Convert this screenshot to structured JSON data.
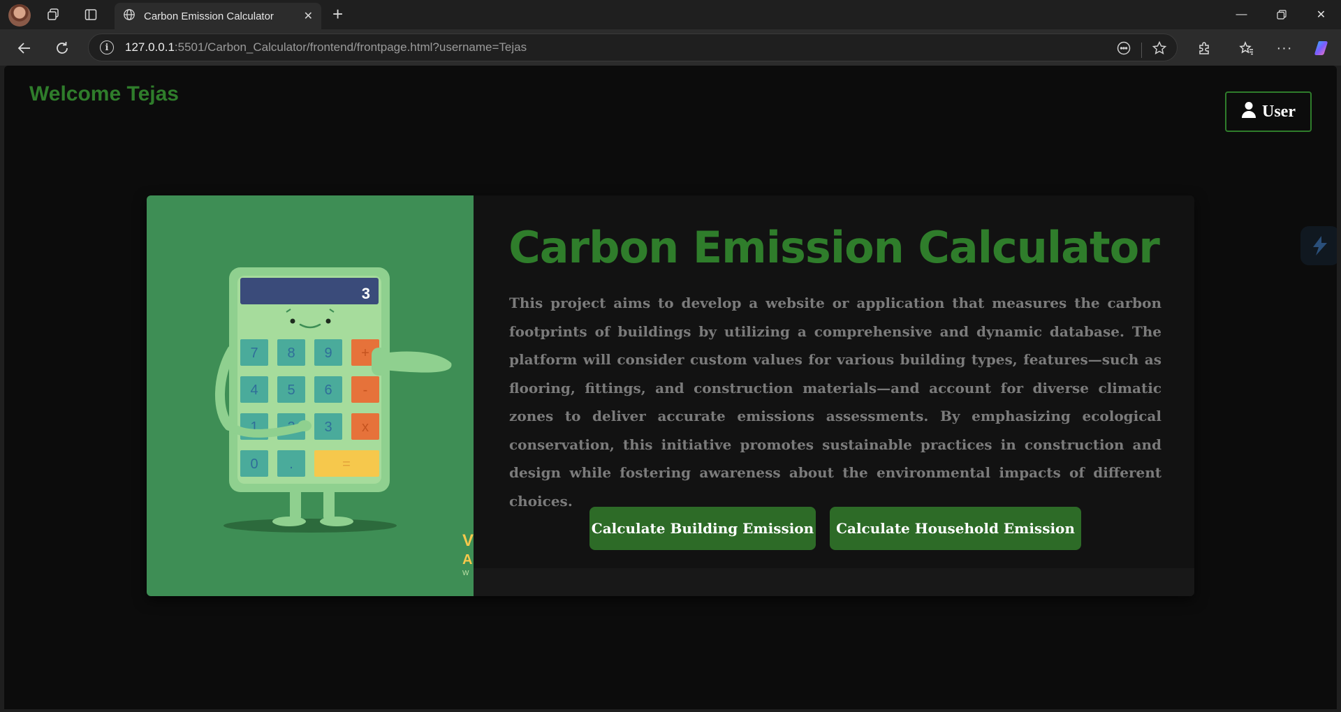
{
  "browser": {
    "tab_title": "Carbon Emission Calculator",
    "url_host": "127.0.0.1",
    "url_rest": ":5501/Carbon_Calculator/frontend/frontpage.html?username=Tejas",
    "icons": [
      "profile-avatar",
      "workspaces-icon",
      "vertical-tabs-icon",
      "globe-icon",
      "close-icon",
      "plus-icon",
      "minimize-icon",
      "restore-icon",
      "close-window-icon",
      "back-icon",
      "refresh-icon",
      "info-icon",
      "reader-icon",
      "favorite-star-icon",
      "extensions-icon",
      "favorites-icon",
      "more-icon",
      "copilot-icon"
    ]
  },
  "page": {
    "welcome": "Welcome Tejas",
    "user_button": "User",
    "title": "Carbon Emission Calculator",
    "description": "This project aims to develop a website or application that measures the carbon footprints of buildings by utilizing a comprehensive and dynamic database. The platform will consider custom values for various building types, features—such as flooring, fittings, and construction materials—and account for diverse climatic zones to deliver accurate emissions assessments. By emphasizing ecological conservation, this initiative promotes sustainable practices in construction and design while fostering awareness about the environmental impacts of different choices.",
    "btn_building": "Calculate Building Emission",
    "btn_household": "Calculate Household Emission",
    "calculator": {
      "display": "3",
      "keys": [
        "7",
        "8",
        "9",
        "+",
        "4",
        "5",
        "6",
        "-",
        "1",
        "2",
        "3",
        "x",
        "0",
        ".",
        "="
      ]
    }
  },
  "colors": {
    "accent_green": "#2f7d2b",
    "button_green": "#2d6b27",
    "illustration_bg": "#3e8e55",
    "page_bg": "#0c0c0c"
  }
}
